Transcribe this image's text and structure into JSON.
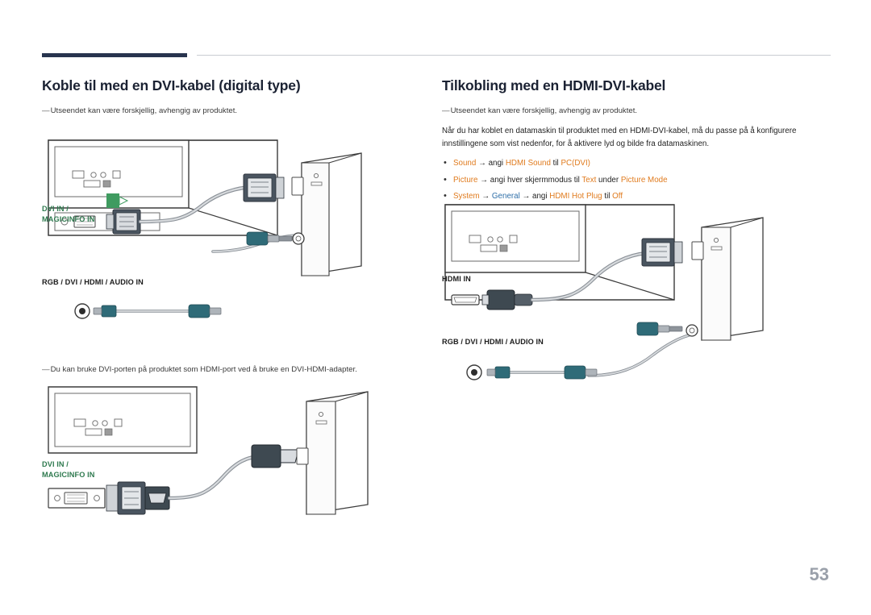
{
  "page": {
    "number": "53"
  },
  "left": {
    "title": "Koble til med en DVI-kabel (digital type)",
    "note_dash": "—",
    "note1": "Utseendet kan være forskjellig, avhengig av produktet.",
    "note2": "Du kan bruke DVI-porten på produktet som HDMI-port ved å bruke en DVI-HDMI-adapter.",
    "labels": {
      "dvi_in_1": "DVI IN /",
      "magicinfo_in_1": "MAGICINFO IN",
      "rgb_dvi_hdmi_audio_in": "RGB / DVI / HDMI / AUDIO IN",
      "dvi_in_2": "DVI IN /",
      "magicinfo_in_2": "MAGICINFO IN"
    }
  },
  "right": {
    "title": "Tilkobling med en HDMI-DVI-kabel",
    "note_dash": "—",
    "note1": "Utseendet kan være forskjellig, avhengig av produktet.",
    "paragraph": "Når du har koblet en datamaskin til produktet med en HDMI-DVI-kabel, må du passe på å konfigurere innstillingene som vist nedenfor, for å aktivere lyd og bilde fra datamaskinen.",
    "bullets": [
      {
        "parts": [
          {
            "text": "Sound",
            "color": "orange"
          },
          {
            "text": " → angi ",
            "color": "black"
          },
          {
            "text": "HDMI Sound",
            "color": "orange"
          },
          {
            "text": " til ",
            "color": "black"
          },
          {
            "text": "PC(DVI)",
            "color": "orange"
          }
        ]
      },
      {
        "parts": [
          {
            "text": "Picture",
            "color": "orange"
          },
          {
            "text": " → angi hver skjermmodus til ",
            "color": "black"
          },
          {
            "text": "Text",
            "color": "orange"
          },
          {
            "text": " under ",
            "color": "black"
          },
          {
            "text": "Picture Mode",
            "color": "orange"
          }
        ]
      },
      {
        "parts": [
          {
            "text": "System",
            "color": "orange"
          },
          {
            "text": " → ",
            "color": "black"
          },
          {
            "text": "General",
            "color": "orange"
          },
          {
            "text": " → angi ",
            "color": "black"
          },
          {
            "text": "HDMI Hot Plug",
            "color": "orange"
          },
          {
            "text": " til ",
            "color": "black"
          },
          {
            "text": "Off",
            "color": "orange"
          }
        ]
      }
    ],
    "labels": {
      "hdmi_in": "HDMI IN",
      "rgb_dvi_hdmi_audio_in": "RGB / DVI / HDMI / AUDIO IN"
    }
  },
  "colors": {
    "accent_rule": "#28344e",
    "orange": "#e07b1e",
    "blue": "#2f6fa8",
    "green_label": "#2f7a4f",
    "page_number": "#9aa0aa"
  }
}
